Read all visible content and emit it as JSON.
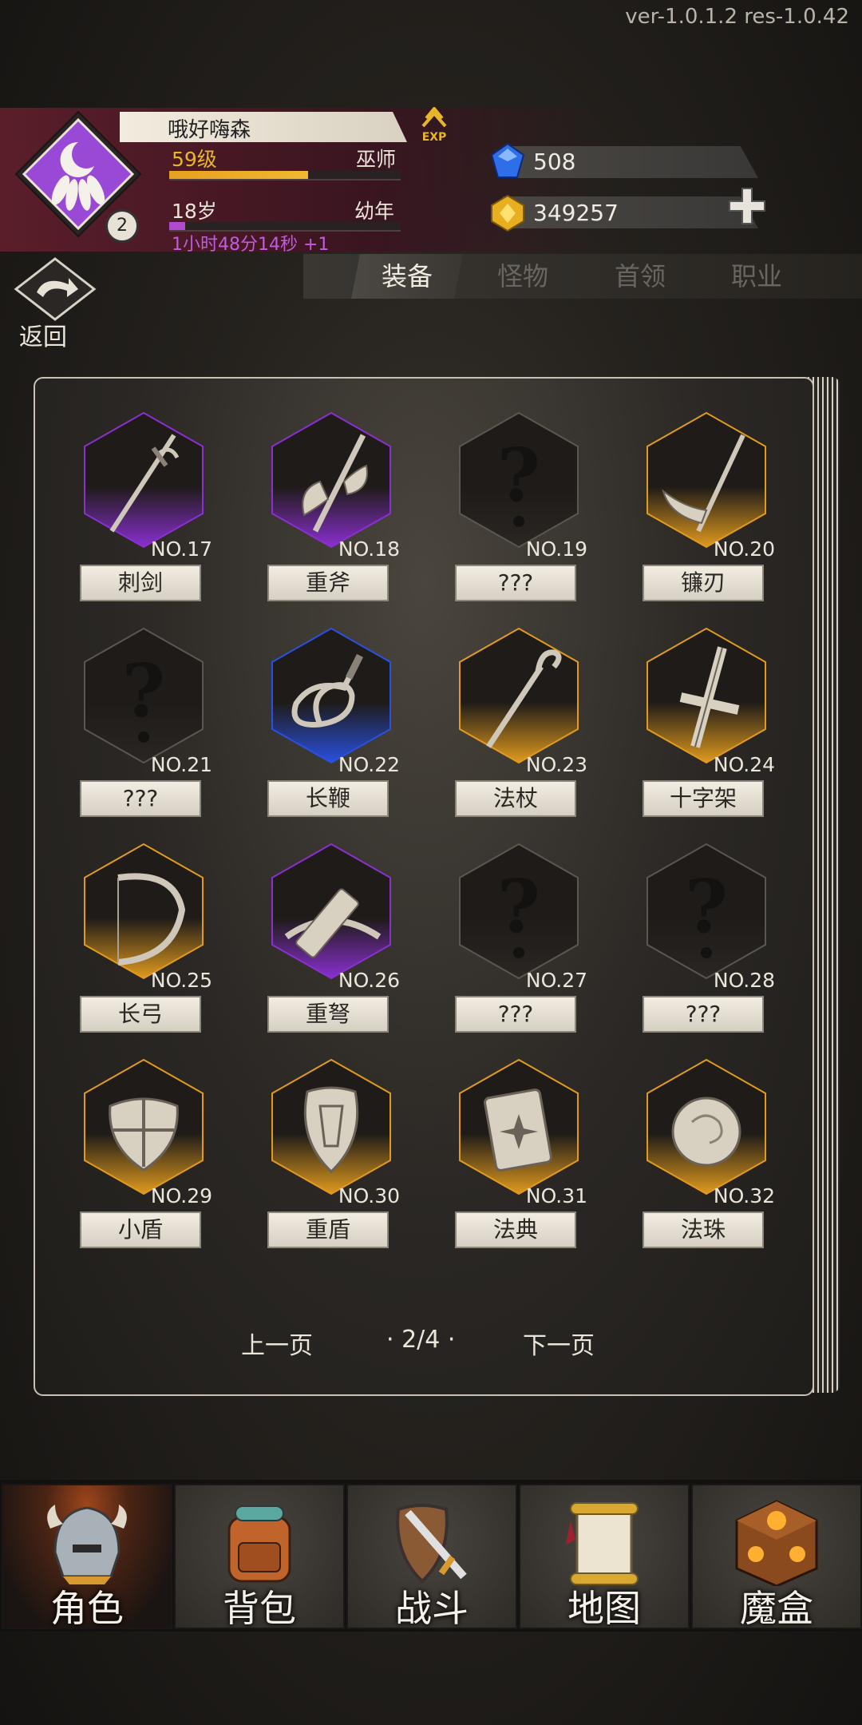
{
  "version": "ver-1.0.1.2  res-1.0.42",
  "player": {
    "name": "哦好嗨森",
    "level": "59级",
    "class": "巫师",
    "level_progress": 0.6,
    "age": "18岁",
    "stage": "幼年",
    "age_progress": 0.07,
    "timer": "1小时48分14秒 +1",
    "avatar_badge": "2",
    "exp_label": "EXP"
  },
  "currency": {
    "gems": "508",
    "gold": "349257"
  },
  "tabs": [
    "装备",
    "怪物",
    "首领",
    "职业"
  ],
  "back_label": "返回",
  "items": [
    {
      "no": "NO.17",
      "name": "刺剑",
      "rarity": "purple",
      "icon": "rapier-icon"
    },
    {
      "no": "NO.18",
      "name": "重斧",
      "rarity": "purple",
      "icon": "axe-icon"
    },
    {
      "no": "NO.19",
      "name": "???",
      "rarity": "locked",
      "icon": "unknown-icon"
    },
    {
      "no": "NO.20",
      "name": "镰刃",
      "rarity": "gold",
      "icon": "scythe-icon"
    },
    {
      "no": "NO.21",
      "name": "???",
      "rarity": "locked",
      "icon": "unknown-icon"
    },
    {
      "no": "NO.22",
      "name": "长鞭",
      "rarity": "blue",
      "icon": "whip-icon"
    },
    {
      "no": "NO.23",
      "name": "法杖",
      "rarity": "gold",
      "icon": "staff-icon"
    },
    {
      "no": "NO.24",
      "name": "十字架",
      "rarity": "gold",
      "icon": "cross-icon"
    },
    {
      "no": "NO.25",
      "name": "长弓",
      "rarity": "gold",
      "icon": "bow-icon"
    },
    {
      "no": "NO.26",
      "name": "重弩",
      "rarity": "purple",
      "icon": "crossbow-icon"
    },
    {
      "no": "NO.27",
      "name": "???",
      "rarity": "locked",
      "icon": "unknown-icon"
    },
    {
      "no": "NO.28",
      "name": "???",
      "rarity": "locked",
      "icon": "unknown-icon"
    },
    {
      "no": "NO.29",
      "name": "小盾",
      "rarity": "gold",
      "icon": "small-shield-icon"
    },
    {
      "no": "NO.30",
      "name": "重盾",
      "rarity": "gold",
      "icon": "heavy-shield-icon"
    },
    {
      "no": "NO.31",
      "name": "法典",
      "rarity": "gold",
      "icon": "tome-icon"
    },
    {
      "no": "NO.32",
      "name": "法珠",
      "rarity": "gold",
      "icon": "orb-icon"
    }
  ],
  "pagination": {
    "prev": "上一页",
    "current": "· 2/4 ·",
    "next": "下一页"
  },
  "nav": [
    {
      "label": "角色",
      "icon": "helmet-icon",
      "active": true
    },
    {
      "label": "背包",
      "icon": "backpack-icon",
      "active": false
    },
    {
      "label": "战斗",
      "icon": "sword-shield-icon",
      "active": false
    },
    {
      "label": "地图",
      "icon": "scroll-map-icon",
      "active": false
    },
    {
      "label": "魔盒",
      "icon": "magic-box-icon",
      "active": false
    }
  ],
  "colors": {
    "purple": "#8a2fd0",
    "gold": "#e09a1e",
    "blue": "#2a50e0",
    "locked": "#5a5650"
  }
}
